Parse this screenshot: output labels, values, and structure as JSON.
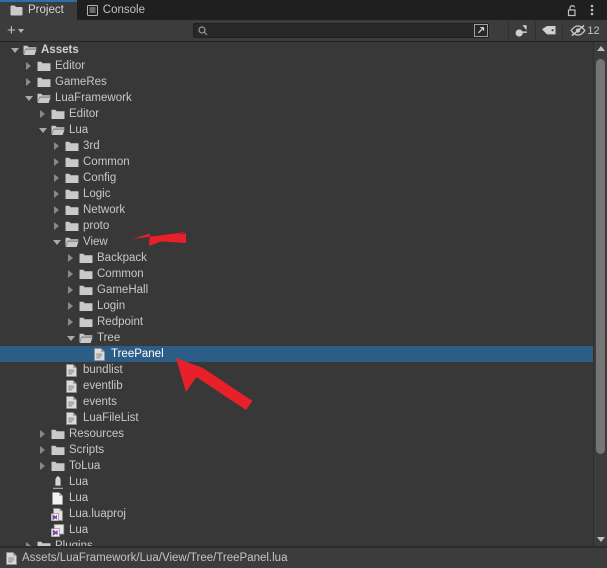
{
  "window": {
    "title": "Project",
    "accent_color": "#2c6fae",
    "selection_color": "#2c5d87",
    "background_color": "#383838",
    "annotation_color": "#e8202a"
  },
  "tabs": [
    {
      "label": "Project",
      "icon": "folder-icon",
      "active": true
    },
    {
      "label": "Console",
      "icon": "console-icon",
      "active": false
    }
  ],
  "tabbar_buttons": [
    {
      "name": "lock-icon",
      "label": "Lock"
    },
    {
      "name": "kebab-menu-icon",
      "label": "More Options"
    }
  ],
  "toolbar": {
    "create_label": "+",
    "create_dropdown_icon": "chevron-down-icon",
    "search": {
      "value": "",
      "placeholder": "",
      "icon": "search-icon"
    },
    "search_expand_icon": "search-expand-icon",
    "filter_type_icon": "asset-type-filter-icon",
    "filter_label_icon": "label-filter-icon",
    "hidden_packages_icon": "eye-slash-icon",
    "hidden_packages_count": "12"
  },
  "tree": {
    "rows": [
      {
        "label": "Assets",
        "depth": 0,
        "twisty": "down",
        "icon": "folder-open-icon",
        "bold": true,
        "selected": false
      },
      {
        "label": "Editor",
        "depth": 1,
        "twisty": "right",
        "icon": "folder-icon",
        "bold": false,
        "selected": false
      },
      {
        "label": "GameRes",
        "depth": 1,
        "twisty": "right",
        "icon": "folder-icon",
        "bold": false,
        "selected": false
      },
      {
        "label": "LuaFramework",
        "depth": 1,
        "twisty": "down",
        "icon": "folder-open-icon",
        "bold": false,
        "selected": false
      },
      {
        "label": "Editor",
        "depth": 2,
        "twisty": "right",
        "icon": "folder-icon",
        "bold": false,
        "selected": false
      },
      {
        "label": "Lua",
        "depth": 2,
        "twisty": "down",
        "icon": "folder-open-icon",
        "bold": false,
        "selected": false
      },
      {
        "label": "3rd",
        "depth": 3,
        "twisty": "right",
        "icon": "folder-icon",
        "bold": false,
        "selected": false
      },
      {
        "label": "Common",
        "depth": 3,
        "twisty": "right",
        "icon": "folder-icon",
        "bold": false,
        "selected": false
      },
      {
        "label": "Config",
        "depth": 3,
        "twisty": "right",
        "icon": "folder-icon",
        "bold": false,
        "selected": false
      },
      {
        "label": "Logic",
        "depth": 3,
        "twisty": "right",
        "icon": "folder-icon",
        "bold": false,
        "selected": false
      },
      {
        "label": "Network",
        "depth": 3,
        "twisty": "right",
        "icon": "folder-icon",
        "bold": false,
        "selected": false
      },
      {
        "label": "proto",
        "depth": 3,
        "twisty": "right",
        "icon": "folder-icon",
        "bold": false,
        "selected": false
      },
      {
        "label": "View",
        "depth": 3,
        "twisty": "down",
        "icon": "folder-open-icon",
        "bold": false,
        "selected": false
      },
      {
        "label": "Backpack",
        "depth": 4,
        "twisty": "right",
        "icon": "folder-icon",
        "bold": false,
        "selected": false
      },
      {
        "label": "Common",
        "depth": 4,
        "twisty": "right",
        "icon": "folder-icon",
        "bold": false,
        "selected": false
      },
      {
        "label": "GameHall",
        "depth": 4,
        "twisty": "right",
        "icon": "folder-icon",
        "bold": false,
        "selected": false
      },
      {
        "label": "Login",
        "depth": 4,
        "twisty": "right",
        "icon": "folder-icon",
        "bold": false,
        "selected": false
      },
      {
        "label": "Redpoint",
        "depth": 4,
        "twisty": "right",
        "icon": "folder-icon",
        "bold": false,
        "selected": false
      },
      {
        "label": "Tree",
        "depth": 4,
        "twisty": "down",
        "icon": "folder-open-icon",
        "bold": false,
        "selected": false
      },
      {
        "label": "TreePanel",
        "depth": 5,
        "twisty": "none",
        "icon": "text-file-icon",
        "bold": false,
        "selected": true
      },
      {
        "label": "bundlist",
        "depth": 3,
        "twisty": "none",
        "icon": "text-file-icon",
        "bold": false,
        "selected": false
      },
      {
        "label": "eventlib",
        "depth": 3,
        "twisty": "none",
        "icon": "text-file-icon",
        "bold": false,
        "selected": false
      },
      {
        "label": "events",
        "depth": 3,
        "twisty": "none",
        "icon": "text-file-icon",
        "bold": false,
        "selected": false
      },
      {
        "label": "LuaFileList",
        "depth": 3,
        "twisty": "none",
        "icon": "text-file-icon",
        "bold": false,
        "selected": false
      },
      {
        "label": "Resources",
        "depth": 2,
        "twisty": "right",
        "icon": "folder-icon",
        "bold": false,
        "selected": false
      },
      {
        "label": "Scripts",
        "depth": 2,
        "twisty": "right",
        "icon": "folder-icon",
        "bold": false,
        "selected": false
      },
      {
        "label": "ToLua",
        "depth": 2,
        "twisty": "right",
        "icon": "folder-icon",
        "bold": false,
        "selected": false
      },
      {
        "label": "Lua",
        "depth": 2,
        "twisty": "none",
        "icon": "default-asset-icon",
        "bold": false,
        "selected": false
      },
      {
        "label": "Lua",
        "depth": 2,
        "twisty": "none",
        "icon": "blank-file-icon",
        "bold": false,
        "selected": false
      },
      {
        "label": "Lua.luaproj",
        "depth": 2,
        "twisty": "none",
        "icon": "vs-project-icon",
        "bold": false,
        "selected": false
      },
      {
        "label": "Lua",
        "depth": 2,
        "twisty": "none",
        "icon": "vs-solution-icon",
        "bold": false,
        "selected": false
      },
      {
        "label": "Plugins",
        "depth": 1,
        "twisty": "right",
        "icon": "folder-icon",
        "bold": false,
        "selected": false
      }
    ]
  },
  "statusbar": {
    "icon": "text-file-icon",
    "path": "Assets/LuaFramework/Lua/View/Tree/TreePanel.lua"
  },
  "annotations": [
    {
      "name": "arrow-pointing-to-view",
      "target": "View"
    },
    {
      "name": "arrow-pointing-to-treepanel",
      "target": "TreePanel"
    }
  ]
}
